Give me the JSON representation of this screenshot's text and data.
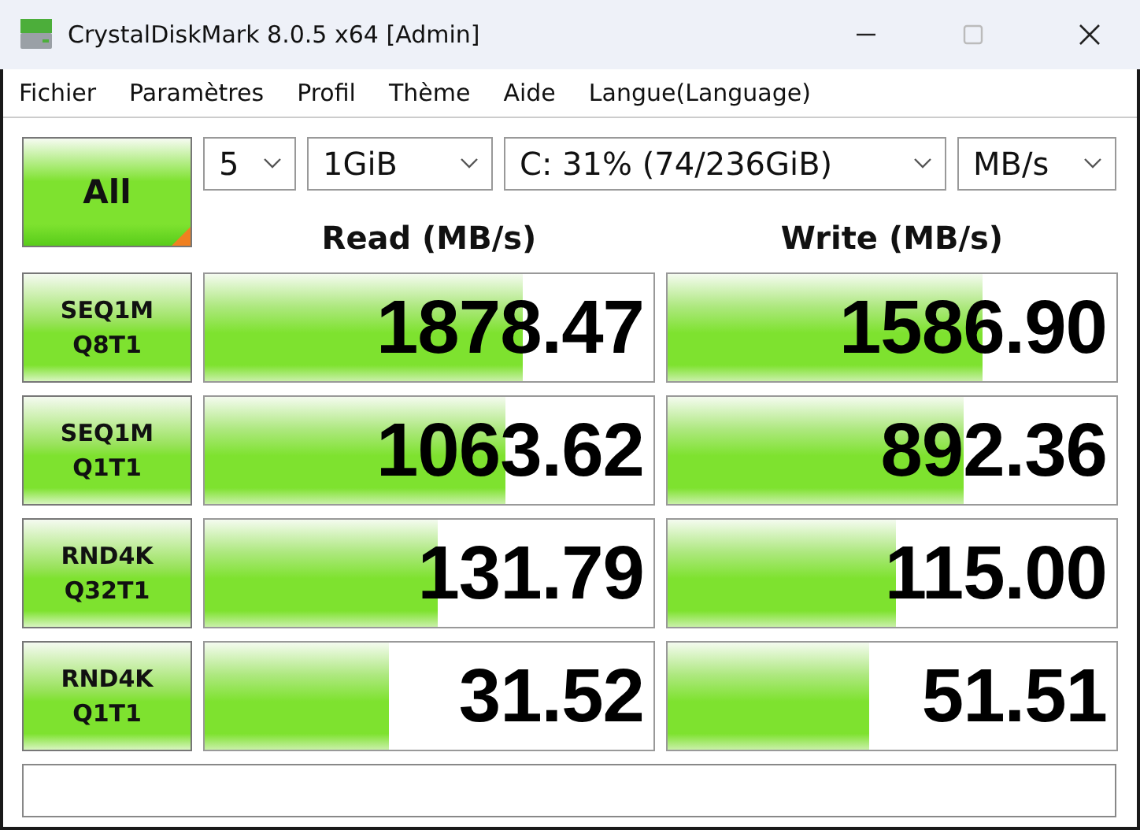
{
  "window": {
    "title": "CrystalDiskMark 8.0.5 x64 [Admin]"
  },
  "menu": [
    "Fichier",
    "Paramètres",
    "Profil",
    "Thème",
    "Aide",
    "Langue(Language)"
  ],
  "all_button": {
    "label": "All"
  },
  "selectors": [
    {
      "value": "5",
      "kind": "count"
    },
    {
      "value": "1GiB",
      "kind": "size"
    },
    {
      "value": "C: 31% (74/236GiB)",
      "kind": "drive"
    },
    {
      "value": "MB/s",
      "kind": "unit"
    }
  ],
  "columns": [
    "Read (MB/s)",
    "Write (MB/s)"
  ],
  "tests": [
    {
      "label": "SEQ1M",
      "sublabel": "Q8T1",
      "read": {
        "value": "1878.47",
        "level": 0.71
      },
      "write": {
        "value": "1586.90",
        "level": 0.7
      }
    },
    {
      "label": "SEQ1M",
      "sublabel": "Q1T1",
      "read": {
        "value": "1063.62",
        "level": 0.67
      },
      "write": {
        "value": "892.36",
        "level": 0.66
      }
    },
    {
      "label": "RND4K",
      "sublabel": "Q32T1",
      "read": {
        "value": "131.79",
        "level": 0.52
      },
      "write": {
        "value": "115.00",
        "level": 0.51
      }
    },
    {
      "label": "RND4K",
      "sublabel": "Q1T1",
      "read": {
        "value": "31.52",
        "level": 0.41
      },
      "write": {
        "value": "51.51",
        "level": 0.45
      }
    }
  ]
}
